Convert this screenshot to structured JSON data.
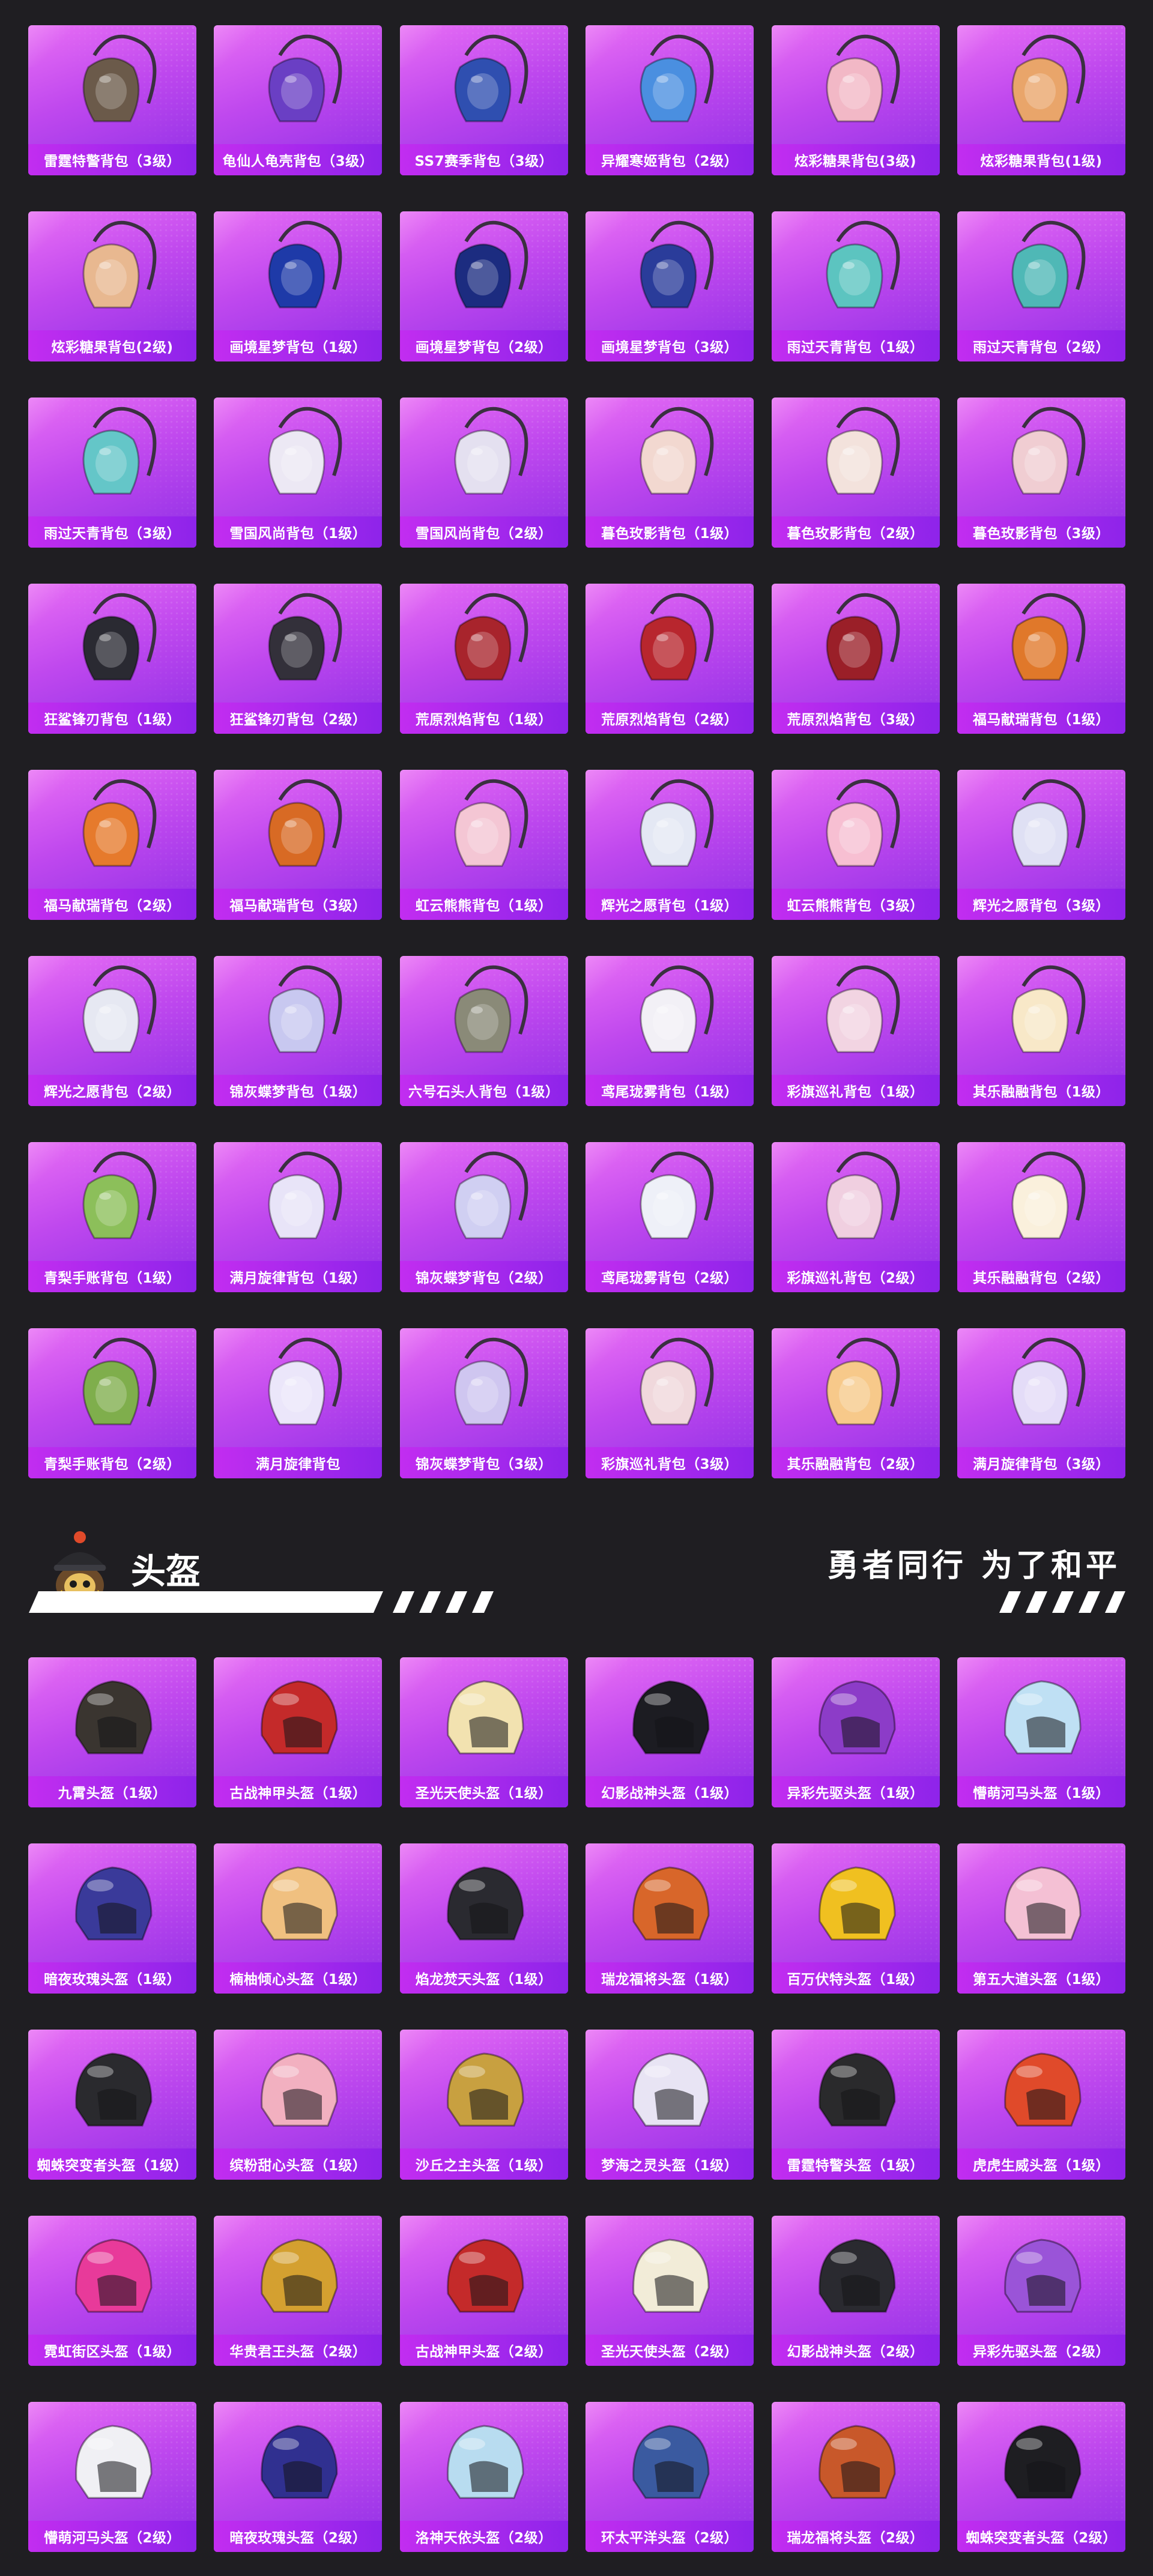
{
  "backpacks": [
    {
      "label": "雷霆特警背包（3级）",
      "icon": "military-backpack-icon",
      "color": "#6b5a4a"
    },
    {
      "label": "龟仙人龟壳背包（3级）",
      "icon": "turtle-shell-backpack-icon",
      "color": "#6a3fc4"
    },
    {
      "label": "SS7赛季背包（3级）",
      "icon": "season-backpack-icon",
      "color": "#2f4fb0"
    },
    {
      "label": "异耀寒姬背包（2级）",
      "icon": "armor-backpack-icon",
      "color": "#4a8fe0"
    },
    {
      "label": "炫彩糖果背包(3级)",
      "icon": "donut-backpack-icon",
      "color": "#f2b8c6"
    },
    {
      "label": "炫彩糖果背包(1级)",
      "icon": "donut-backpack-icon",
      "color": "#e9a56a"
    },
    {
      "label": "炫彩糖果背包(2级)",
      "icon": "donut-backpack-icon",
      "color": "#e8b890"
    },
    {
      "label": "画境星梦背包（1级）",
      "icon": "book-backpack-icon",
      "color": "#1e3aa8"
    },
    {
      "label": "画境星梦背包（2级）",
      "icon": "book-backpack-icon",
      "color": "#1c2c80"
    },
    {
      "label": "画境星梦背包（3级）",
      "icon": "mirror-backpack-icon",
      "color": "#2a3c9a"
    },
    {
      "label": "雨过天青背包（1级）",
      "icon": "flower-backpack-icon",
      "color": "#5cc4c0"
    },
    {
      "label": "雨过天青背包（2级）",
      "icon": "flower-backpack-icon",
      "color": "#4fb8b6"
    },
    {
      "label": "雨过天青背包（3级）",
      "icon": "flower-backpack-icon",
      "color": "#64c6c8"
    },
    {
      "label": "雪国风尚背包（1级）",
      "icon": "bunny-backpack-icon",
      "color": "#ece8f4"
    },
    {
      "label": "雪国风尚背包（2级）",
      "icon": "bunny-backpack-icon",
      "color": "#e4e0f0"
    },
    {
      "label": "暮色玫影背包（1级）",
      "icon": "bat-plush-backpack-icon",
      "color": "#f2d8d0"
    },
    {
      "label": "暮色玫影背包（2级）",
      "icon": "doll-backpack-icon",
      "color": "#f3e2dc"
    },
    {
      "label": "暮色玫影背包（3级）",
      "icon": "doll-backpack-icon",
      "color": "#f0cdd2"
    },
    {
      "label": "狂鲨锋刃背包（1级）",
      "icon": "shark-backpack-icon",
      "color": "#2a2a32"
    },
    {
      "label": "狂鲨锋刃背包（2级）",
      "icon": "shark-backpack-icon",
      "color": "#33303a"
    },
    {
      "label": "荒原烈焰背包（1级）",
      "icon": "flame-backpack-icon",
      "color": "#a8242c"
    },
    {
      "label": "荒原烈焰背包（2级）",
      "icon": "flame-backpack-icon",
      "color": "#b8262e"
    },
    {
      "label": "荒原烈焰背包（3级）",
      "icon": "flame-backpack-icon",
      "color": "#9a1f28"
    },
    {
      "label": "福马献瑞背包（1级）",
      "icon": "horse-backpack-icon",
      "color": "#e0782a"
    },
    {
      "label": "福马献瑞背包（2级）",
      "icon": "horse-backpack-icon",
      "color": "#e67a2c"
    },
    {
      "label": "福马献瑞背包（3级）",
      "icon": "horse-backpack-icon",
      "color": "#d86a24"
    },
    {
      "label": "虹云熊熊背包（1级）",
      "icon": "cloud-bear-backpack-icon",
      "color": "#f4c6d4"
    },
    {
      "label": "辉光之愿背包（1级）",
      "icon": "gem-backpack-icon",
      "color": "#e4e8f4"
    },
    {
      "label": "虹云熊熊背包（3级）",
      "icon": "cloud-bear-backpack-icon",
      "color": "#f7bfd2"
    },
    {
      "label": "辉光之愿背包（3级）",
      "icon": "gem-backpack-icon",
      "color": "#dfe0f4"
    },
    {
      "label": "辉光之愿背包（2级）",
      "icon": "gem-backpack-icon",
      "color": "#e6e8f2"
    },
    {
      "label": "锦灰蝶梦背包（1级）",
      "icon": "butterfly-backpack-icon",
      "color": "#c8c8f0"
    },
    {
      "label": "六号石头人背包（1级）",
      "icon": "stone-man-backpack-icon",
      "color": "#8a8a78"
    },
    {
      "label": "鸢尾珑雾背包（1级）",
      "icon": "pouch-backpack-icon",
      "color": "#f2f0f6"
    },
    {
      "label": "彩旗巡礼背包（1级）",
      "icon": "flag-backpack-icon",
      "color": "#f2d4e2"
    },
    {
      "label": "其乐融融背包（1级）",
      "icon": "cake-backpack-icon",
      "color": "#f8e8c8"
    },
    {
      "label": "青梨手账背包（1级）",
      "icon": "pear-backpack-icon",
      "color": "#8cbf5a"
    },
    {
      "label": "满月旋律背包（1级）",
      "icon": "moon-backpack-icon",
      "color": "#e8e4f8"
    },
    {
      "label": "锦灰蝶梦背包（2级）",
      "icon": "butterfly-backpack-icon",
      "color": "#d0cff2"
    },
    {
      "label": "鸢尾珑雾背包（2级）",
      "icon": "pouch-backpack-icon",
      "color": "#eef0f8"
    },
    {
      "label": "彩旗巡礼背包（2级）",
      "icon": "flag-backpack-icon",
      "color": "#f0cfe0"
    },
    {
      "label": "其乐融融背包（2级）",
      "icon": "cake-backpack-icon",
      "color": "#faf0dc"
    },
    {
      "label": "青梨手账背包（2级）",
      "icon": "pear-backpack-icon",
      "color": "#7fae4c"
    },
    {
      "label": "满月旋律背包",
      "icon": "moon-backpack-icon",
      "color": "#ebe6fa"
    },
    {
      "label": "锦灰蝶梦背包（3级）",
      "icon": "butterfly-backpack-icon",
      "color": "#cfc6f0"
    },
    {
      "label": "彩旗巡礼背包（3级）",
      "icon": "flag-backpack-icon",
      "color": "#f0d8dc"
    },
    {
      "label": "其乐融融背包（2级）",
      "icon": "cake-backpack-icon",
      "color": "#f7c98a"
    },
    {
      "label": "满月旋律背包（3级）",
      "icon": "moon-backpack-icon",
      "color": "#e4dcf8"
    }
  ],
  "helmet_section": {
    "title": "头盔",
    "slogan": "勇者同行 为了和平",
    "mascot_icon": "knight-mascot-icon"
  },
  "helmets": [
    {
      "label": "九霄头盔（1级）",
      "icon": "helmet-icon",
      "color": "#3a3530"
    },
    {
      "label": "古战神甲头盔（1级）",
      "icon": "helmet-icon",
      "color": "#c42a2a"
    },
    {
      "label": "圣光天使头盔（1级）",
      "icon": "helmet-icon",
      "color": "#f2e2b0"
    },
    {
      "label": "幻影战神头盔（1级）",
      "icon": "helmet-icon",
      "color": "#1c1c22"
    },
    {
      "label": "异彩先驱头盔（1级）",
      "icon": "helmet-icon",
      "color": "#8c3cc8"
    },
    {
      "label": "懵萌河马头盔（1级）",
      "icon": "helmet-icon",
      "color": "#bfe0f4"
    },
    {
      "label": "暗夜玫瑰头盔（1级）",
      "icon": "helmet-icon",
      "color": "#3a3a9a"
    },
    {
      "label": "楠柚倾心头盔（1级）",
      "icon": "helmet-icon",
      "color": "#f0c080"
    },
    {
      "label": "焰龙焚天头盔（1级）",
      "icon": "helmet-icon",
      "color": "#2a2a30"
    },
    {
      "label": "瑞龙福将头盔（1级）",
      "icon": "helmet-icon",
      "color": "#d8662a"
    },
    {
      "label": "百万伏特头盔（1级）",
      "icon": "helmet-icon",
      "color": "#f0c020"
    },
    {
      "label": "第五大道头盔（1级）",
      "icon": "helmet-icon",
      "color": "#f4c0d4"
    },
    {
      "label": "蜘蛛突变者头盔（1级）",
      "icon": "helmet-icon",
      "color": "#2a2a2e"
    },
    {
      "label": "缤粉甜心头盔（1级）",
      "icon": "helmet-icon",
      "color": "#f2b0c0"
    },
    {
      "label": "沙丘之主头盔（1级）",
      "icon": "helmet-icon",
      "color": "#c8a040"
    },
    {
      "label": "梦海之灵头盔（1级）",
      "icon": "helmet-icon",
      "color": "#e8e4f4"
    },
    {
      "label": "雷霆特警头盔（1级）",
      "icon": "helmet-icon",
      "color": "#2a2a2c"
    },
    {
      "label": "虎虎生威头盔（1级）",
      "icon": "helmet-icon",
      "color": "#e04a2a"
    },
    {
      "label": "霓虹街区头盔（1级）",
      "icon": "helmet-icon",
      "color": "#e83a9a"
    },
    {
      "label": "华贵君王头盔（2级）",
      "icon": "helmet-icon",
      "color": "#d4a030"
    },
    {
      "label": "古战神甲头盔（2级）",
      "icon": "helmet-icon",
      "color": "#c42a2a"
    },
    {
      "label": "圣光天使头盔（2级）",
      "icon": "helmet-icon",
      "color": "#f2ecd8"
    },
    {
      "label": "幻影战神头盔（2级）",
      "icon": "helmet-icon",
      "color": "#2a2a30"
    },
    {
      "label": "异彩先驱头盔（2级）",
      "icon": "helmet-icon",
      "color": "#9a54d8"
    },
    {
      "label": "懵萌河马头盔（2级）",
      "icon": "helmet-icon",
      "color": "#f0f0f4"
    },
    {
      "label": "暗夜玫瑰头盔（2级）",
      "icon": "helmet-icon",
      "color": "#303090"
    },
    {
      "label": "洛神天依头盔（2级）",
      "icon": "helmet-icon",
      "color": "#b8dcf0"
    },
    {
      "label": "环太平洋头盔（2级）",
      "icon": "helmet-icon",
      "color": "#3a5aa0"
    },
    {
      "label": "瑞龙福将头盔（2级）",
      "icon": "helmet-icon",
      "color": "#c8582a"
    },
    {
      "label": "蜘蛛突变者头盔（2级）",
      "icon": "helmet-icon",
      "color": "#1e1e22"
    }
  ]
}
